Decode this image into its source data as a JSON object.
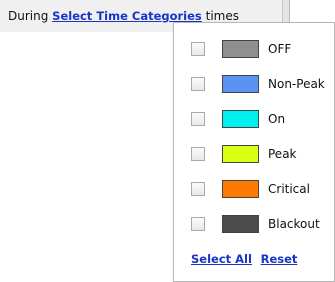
{
  "header": {
    "prefix": "During",
    "link_label": "Select Time Categories",
    "suffix": "times"
  },
  "categories": [
    {
      "label": "OFF",
      "color": "#8f8f8f",
      "checked": false
    },
    {
      "label": "Non-Peak",
      "color": "#5b93f2",
      "checked": false
    },
    {
      "label": "On",
      "color": "#00f0f0",
      "checked": false
    },
    {
      "label": "Peak",
      "color": "#d9ff12",
      "checked": false
    },
    {
      "label": "Critical",
      "color": "#ff7a00",
      "checked": false
    },
    {
      "label": "Blackout",
      "color": "#4b4b4b",
      "checked": false
    }
  ],
  "actions": {
    "select_all": "Select All",
    "reset": "Reset"
  }
}
